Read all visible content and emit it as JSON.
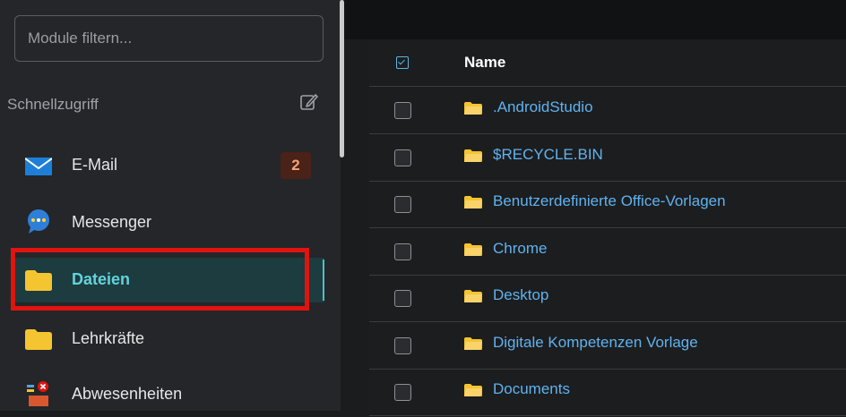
{
  "sidebar": {
    "filter_placeholder": "Module filtern...",
    "section_title": "Schnellzugriff",
    "items": [
      {
        "label": "E-Mail",
        "icon": "mail-icon",
        "badge": "2"
      },
      {
        "label": "Messenger",
        "icon": "messenger-icon"
      },
      {
        "label": "Dateien",
        "icon": "folder-icon",
        "active": true
      },
      {
        "label": "Lehrkräfte",
        "icon": "folder-icon"
      },
      {
        "label": "Abwesenheiten",
        "icon": "absence-icon"
      }
    ]
  },
  "files": {
    "header_name": "Name",
    "rows": [
      ".AndroidStudio",
      "$RECYCLE.BIN",
      "Benutzerdefinierte Office-Vorlagen",
      "Chrome",
      "Desktop",
      "Digitale Kompetenzen Vorlage",
      "Documents"
    ]
  },
  "colors": {
    "accent": "#64d2dc",
    "link": "#5fb3f0",
    "highlight": "#e0140f",
    "folder": "#f5c431"
  }
}
